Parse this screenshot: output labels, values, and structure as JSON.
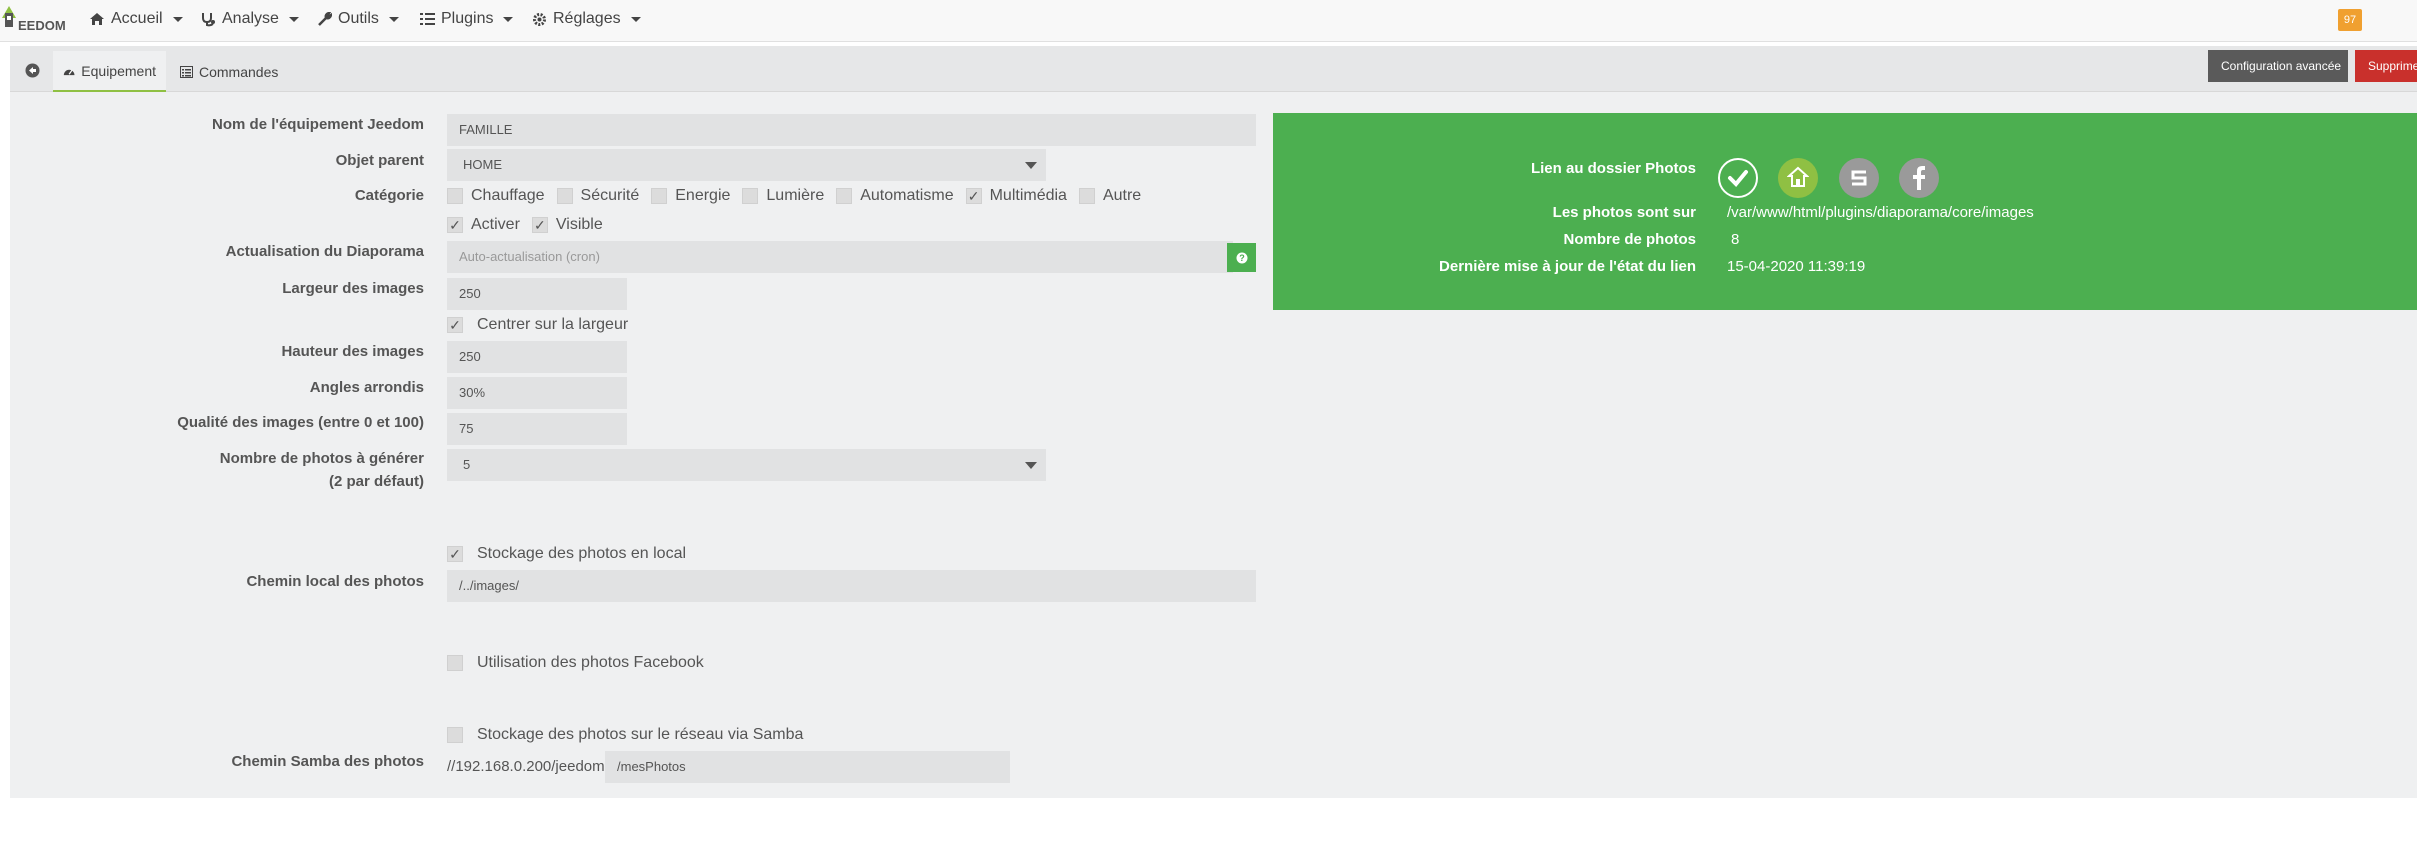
{
  "navbar": {
    "logo_text": "EEDOM",
    "items": [
      {
        "label": "Accueil",
        "icon": "home-icon"
      },
      {
        "label": "Analyse",
        "icon": "stethoscope-icon"
      },
      {
        "label": "Outils",
        "icon": "wrench-icon"
      },
      {
        "label": "Plugins",
        "icon": "tasks-icon"
      },
      {
        "label": "Réglages",
        "icon": "cogs-icon"
      }
    ],
    "badge": "97"
  },
  "tabs": {
    "equipement": "Equipement",
    "commandes": "Commandes"
  },
  "buttons": {
    "config_avancee": "Configuration avancée",
    "supprimer": "Supprimer"
  },
  "form": {
    "nom_label": "Nom de l'équipement Jeedom",
    "nom_value": "FAMILLE",
    "objet_label": "Objet parent",
    "objet_value": "HOME",
    "categorie_label": "Catégorie",
    "categories": [
      {
        "label": "Chauffage",
        "checked": false
      },
      {
        "label": "Sécurité",
        "checked": false
      },
      {
        "label": "Energie",
        "checked": false
      },
      {
        "label": "Lumière",
        "checked": false
      },
      {
        "label": "Automatisme",
        "checked": false
      },
      {
        "label": "Multimédia",
        "checked": true
      },
      {
        "label": "Autre",
        "checked": false
      }
    ],
    "activer": "Activer",
    "visible": "Visible",
    "actualisation_label": "Actualisation du Diaporama",
    "actualisation_placeholder": "Auto-actualisation (cron)",
    "largeur_label": "Largeur des images",
    "largeur_value": "250",
    "centrer": "Centrer sur la largeur",
    "hauteur_label": "Hauteur des images",
    "hauteur_value": "250",
    "angles_label": "Angles arrondis",
    "angles_value": "30%",
    "qualite_label": "Qualité des images (entre 0 et 100)",
    "qualite_value": "75",
    "nombre_label_1": "Nombre de photos à générer",
    "nombre_label_2": "(2 par défaut)",
    "nombre_value": "5",
    "stockage_local": "Stockage des photos en local",
    "chemin_local_label": "Chemin local des photos",
    "chemin_local_value": "/../images/",
    "facebook": "Utilisation des photos Facebook",
    "samba": "Stockage des photos sur le réseau via Samba",
    "chemin_samba_label": "Chemin Samba des photos",
    "samba_prefix": "//192.168.0.200/jeedom",
    "samba_value": "/mesPhotos"
  },
  "panel": {
    "lien_label": "Lien au dossier Photos",
    "photos_sur_label": "Les photos sont sur",
    "photos_sur_value": "/var/www/html/plugins/diaporama/core/images",
    "nombre_label": "Nombre de photos",
    "nombre_value": "8",
    "maj_label": "Dernière mise à jour de l'état du lien",
    "maj_value": "15-04-2020 11:39:19",
    "color": "#4caf50"
  }
}
